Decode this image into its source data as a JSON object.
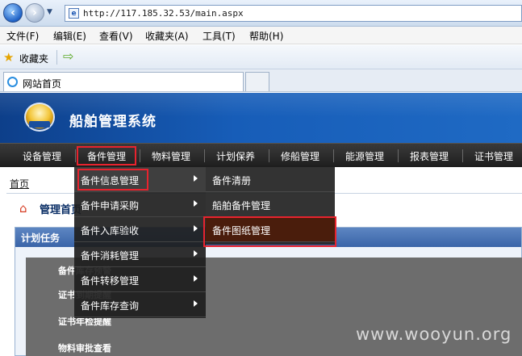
{
  "browser": {
    "url": "http://117.185.32.53/main.aspx",
    "menu": [
      "文件(F)",
      "编辑(E)",
      "查看(V)",
      "收藏夹(A)",
      "工具(T)",
      "帮助(H)"
    ],
    "favorites_label": "收藏夹",
    "tab_title": "网站首页"
  },
  "site": {
    "title": "船舶管理系统",
    "nav": [
      "设备管理",
      "备件管理",
      "物料管理",
      "计划保养",
      "修船管理",
      "能源管理",
      "报表管理",
      "证书管理"
    ]
  },
  "content": {
    "breadcrumb": "首页",
    "page_title": "管理首页",
    "panel_title": "计划任务",
    "tasks": [
      "备件库存预警",
      "证书到期提醒",
      "证书年检提醒",
      "物料审批查看"
    ]
  },
  "dropdown": {
    "level1": [
      "备件信息管理",
      "备件申请采购",
      "备件入库验收",
      "备件消耗管理",
      "备件转移管理",
      "备件库存查询"
    ],
    "level2": [
      "备件清册",
      "船舶备件管理",
      "备件图纸管理"
    ]
  },
  "watermark": "www.wooyun.org",
  "colors": {
    "header_blue": "#175db8",
    "nav_dark": "#1e1e1e",
    "highlight_red": "#e8232e"
  }
}
